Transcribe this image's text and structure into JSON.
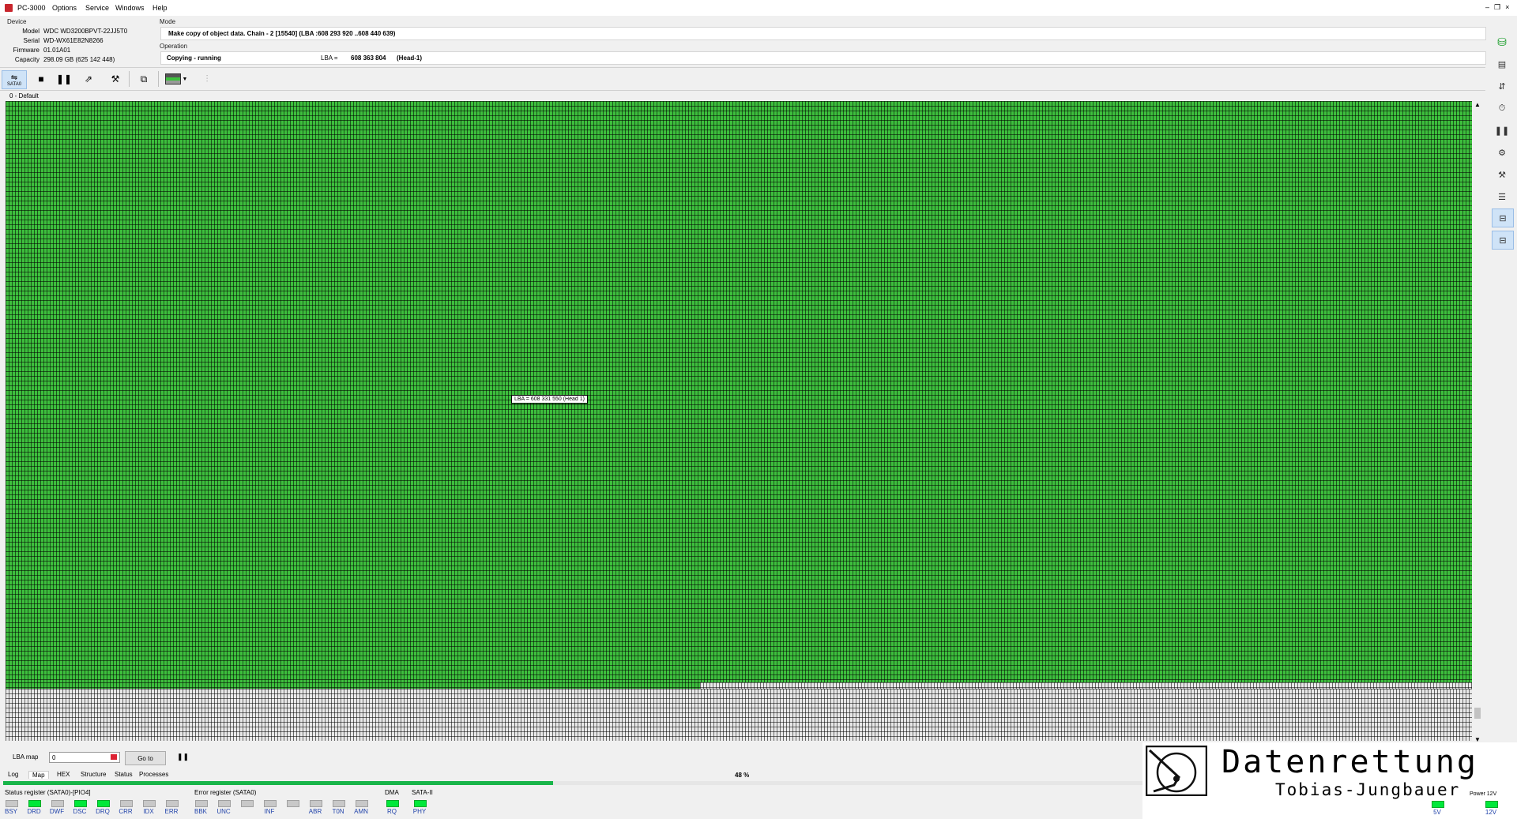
{
  "window": {
    "title": "PC-3000",
    "menu": [
      "Options",
      "Service",
      "Windows",
      "Help"
    ]
  },
  "device": {
    "caption": "Device",
    "fields": [
      {
        "label": "Model",
        "value": "WDC WD3200BPVT-22JJ5T0"
      },
      {
        "label": "Serial",
        "value": "WD-WX61E82N8266"
      },
      {
        "label": "Firmware",
        "value": "01.01A01"
      },
      {
        "label": "Capacity",
        "value": "298.09 GB (625 142 448)"
      }
    ]
  },
  "mode": {
    "caption": "Mode",
    "text": "Make copy of object data. Chain - 2 [15540] (LBA :608 293 920 ..608 440 639)",
    "operation_caption": "Operation",
    "operation_status": "Copying - running",
    "lba_label": "LBA =",
    "lba_value": "608 363 804",
    "head": "(Head-1)"
  },
  "toolbar": {
    "sata_label": "SATA0"
  },
  "map": {
    "caption": "0 - Default",
    "tooltip": "LBA = 608 331 550 (Head 1)",
    "completed_fraction": 0.9
  },
  "lba_map": {
    "label": "LBA map",
    "input_value": "0",
    "goto_label": "Go to"
  },
  "tabs": [
    "Log",
    "Map",
    "HEX",
    "Structure",
    "Status",
    "Processes"
  ],
  "progress": {
    "percent": 48,
    "text": "48 %"
  },
  "status_register": {
    "caption": "Status register (SATA0)-[PIO4]",
    "bits": [
      {
        "name": "BSY",
        "on": false
      },
      {
        "name": "DRD",
        "on": true
      },
      {
        "name": "DWF",
        "on": false
      },
      {
        "name": "DSC",
        "on": true
      },
      {
        "name": "DRQ",
        "on": true
      },
      {
        "name": "CRR",
        "on": false
      },
      {
        "name": "IDX",
        "on": false
      },
      {
        "name": "ERR",
        "on": false
      }
    ]
  },
  "error_register": {
    "caption": "Error register (SATA0)",
    "bits": [
      {
        "name": "BBK",
        "on": false
      },
      {
        "name": "UNC",
        "on": false
      },
      {
        "name": "",
        "on": false
      },
      {
        "name": "INF",
        "on": false
      },
      {
        "name": "",
        "on": false
      },
      {
        "name": "ABR",
        "on": false
      },
      {
        "name": "T0N",
        "on": false
      },
      {
        "name": "AMN",
        "on": false
      }
    ]
  },
  "dma": {
    "caption": "DMA",
    "bit": "RQ",
    "on": true
  },
  "sata": {
    "caption": "SATA-II",
    "bit": "PHY",
    "on": true
  },
  "power": {
    "power_caption": "Power 12V",
    "v5_label": "5V",
    "v12_label": "12V"
  },
  "logo": {
    "main": "Datenrettung",
    "sub": "Tobias-Jungbauer"
  },
  "colors": {
    "map_done": "#3dbf3d",
    "map_pending": "#e8e8e8",
    "progress": "#19b54a",
    "led_on": "#00e83a"
  }
}
